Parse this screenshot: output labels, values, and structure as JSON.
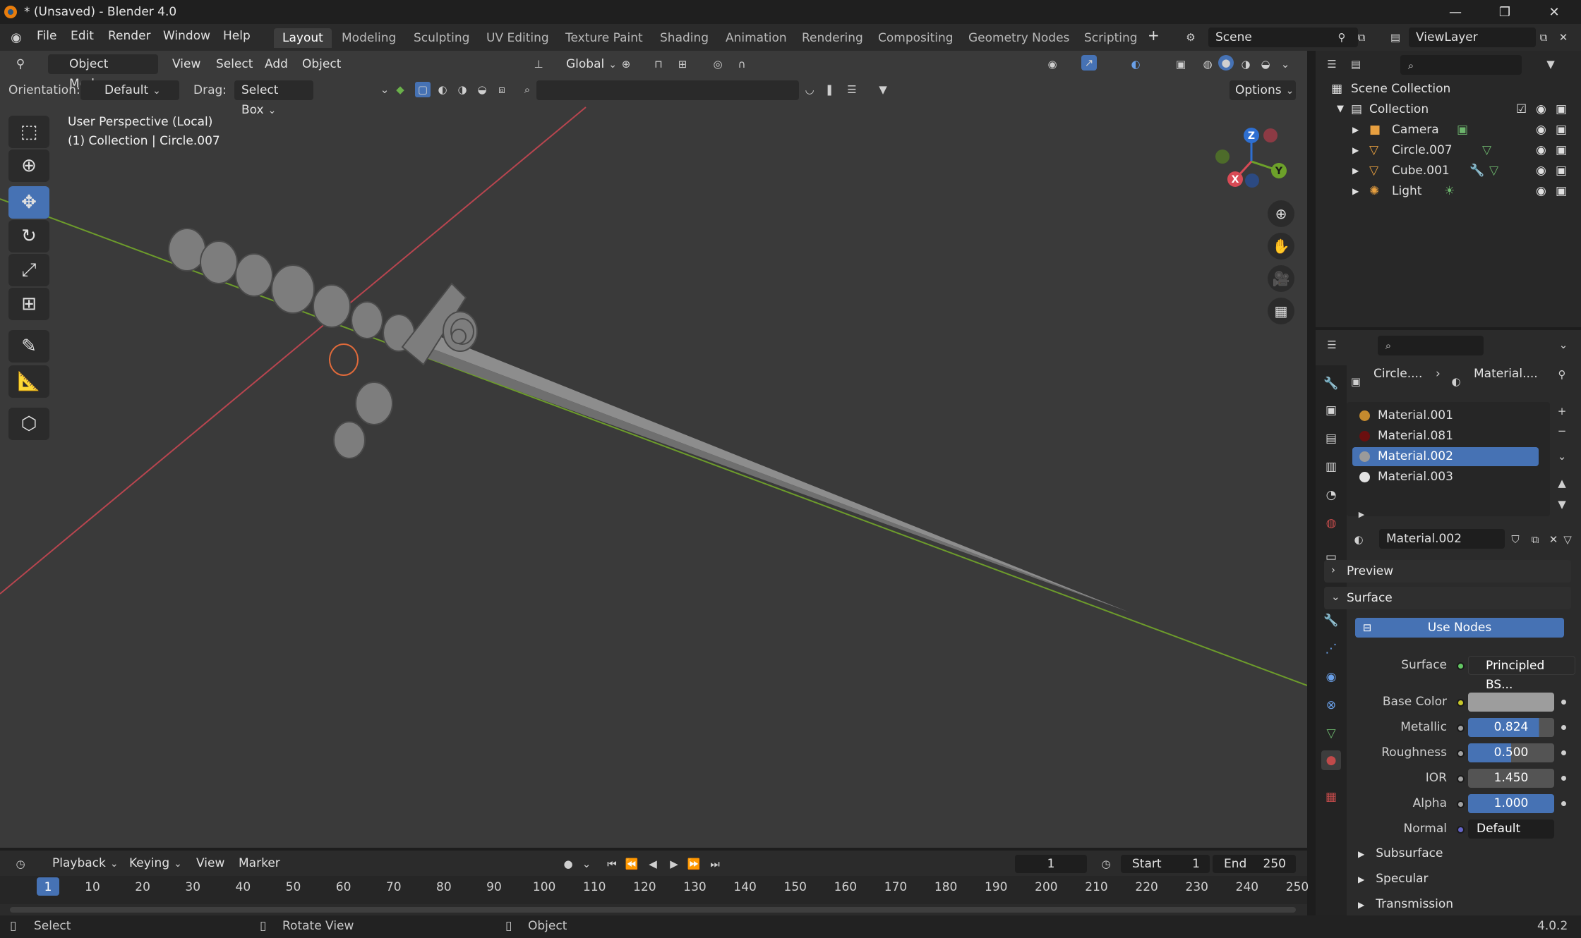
{
  "window": {
    "title": "* (Unsaved) - Blender 4.0",
    "controls": [
      "—",
      "❐",
      "✕"
    ]
  },
  "menus": [
    "File",
    "Edit",
    "Render",
    "Window",
    "Help"
  ],
  "workspaces": {
    "tabs": [
      "Layout",
      "Modeling",
      "Sculpting",
      "UV Editing",
      "Texture Paint",
      "Shading",
      "Animation",
      "Rendering",
      "Compositing",
      "Geometry Nodes",
      "Scripting"
    ],
    "active": "Layout",
    "add": "+"
  },
  "scene": {
    "label": "Scene",
    "view_layer": "ViewLayer"
  },
  "viewport": {
    "mode": "Object Mode",
    "menus": [
      "View",
      "Select",
      "Add",
      "Object"
    ],
    "transform_orientation": "Global",
    "orientation_label": "Orientation:",
    "orientation_value": "Default",
    "drag_label": "Drag:",
    "drag_value": "Select Box",
    "options": "Options",
    "info_line1": "User Perspective (Local)",
    "info_line2": "(1) Collection | Circle.007",
    "gizmo_axes": {
      "z": "Z",
      "y": "Y",
      "x": "X"
    },
    "colors": {
      "x_axis": "#d84a55",
      "y_axis": "#6da12a",
      "z_axis": "#2e6fd1",
      "background": "#3a3a3a"
    }
  },
  "outliner": {
    "root": "Scene Collection",
    "collection": "Collection",
    "items": [
      {
        "name": "Camera"
      },
      {
        "name": "Circle.007"
      },
      {
        "name": "Cube.001"
      },
      {
        "name": "Light"
      }
    ]
  },
  "properties": {
    "breadcrumb": {
      "object": "Circle....",
      "material": "Material...."
    },
    "material_slots": [
      {
        "name": "Material.001",
        "color": "#c48a2e"
      },
      {
        "name": "Material.081",
        "color": "#6a0f0f"
      },
      {
        "name": "Material.002",
        "color": "#9a9a9a"
      },
      {
        "name": "Material.003",
        "color": "#e2e2e2"
      }
    ],
    "active_slot": "Material.002",
    "material_name": "Material.002",
    "panels": {
      "preview": "Preview",
      "surface": "Surface"
    },
    "use_nodes": "Use Nodes",
    "surface_label": "Surface",
    "surface_value": "Principled BS...",
    "base_color_label": "Base Color",
    "base_color": "#9d9d9d",
    "metallic_label": "Metallic",
    "metallic_value": "0.824",
    "metallic_fill": 0.824,
    "roughness_label": "Roughness",
    "roughness_value": "0.500",
    "roughness_fill": 0.5,
    "ior_label": "IOR",
    "ior_value": "1.450",
    "alpha_label": "Alpha",
    "alpha_value": "1.000",
    "alpha_fill": 1.0,
    "normal_label": "Normal",
    "normal_value": "Default",
    "subpanels": [
      "Subsurface",
      "Specular",
      "Transmission"
    ]
  },
  "timeline": {
    "menus": [
      "Playback",
      "Keying",
      "View",
      "Marker"
    ],
    "current_frame": "1",
    "start_label": "Start",
    "start_value": "1",
    "end_label": "End",
    "end_value": "250",
    "ruler": [
      "1",
      "10",
      "20",
      "30",
      "40",
      "50",
      "60",
      "70",
      "80",
      "90",
      "100",
      "110",
      "120",
      "130",
      "140",
      "150",
      "160",
      "170",
      "180",
      "190",
      "200",
      "210",
      "220",
      "230",
      "240",
      "250"
    ]
  },
  "statusbar": {
    "left": "Select",
    "middle": "Rotate View",
    "right": "Object",
    "version": "4.0.2"
  }
}
